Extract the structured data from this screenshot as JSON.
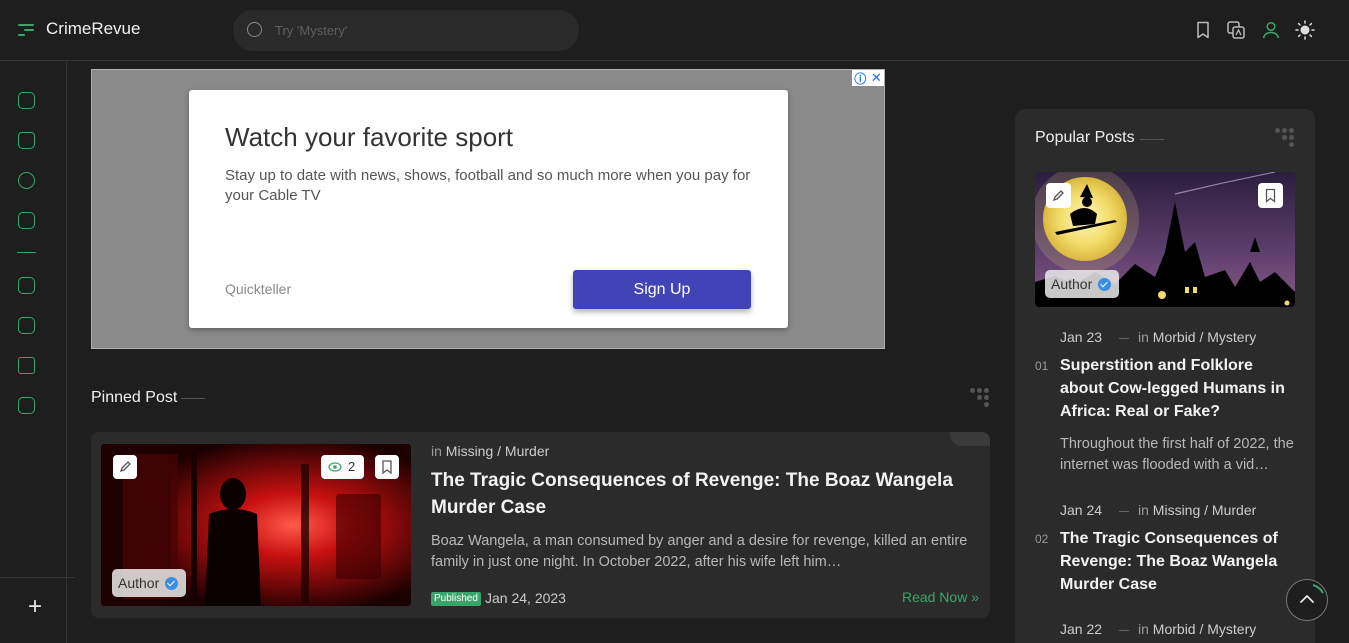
{
  "header": {
    "brand": "CrimeRevue",
    "search_placeholder": "Try 'Mystery'",
    "icons": [
      "bookmark-icon",
      "translate-icon",
      "user-icon",
      "theme-toggle-icon"
    ]
  },
  "sidebar": {
    "items": [
      "dashboard-icon",
      "home-icon",
      "users-icon",
      "mail-icon",
      "page-icon",
      "page-icon",
      "lock-icon",
      "page-icon"
    ]
  },
  "ad": {
    "title": "Watch your favorite sport",
    "text": "Stay up to date with news, shows, football and so much more when you pay for your Cable TV",
    "brand": "Quickteller",
    "cta": "Sign Up"
  },
  "pinned": {
    "section_title": "Pinned Post",
    "views": "2",
    "author": "Author",
    "in_prefix": "in",
    "category": "Missing / Murder",
    "title": "The Tragic Consequences of Revenge: The Boaz Wangela Murder Case",
    "excerpt": "Boaz Wangela, a man consumed by anger and a desire for revenge, killed an entire family in just one night. In October 2022, after his wife left him…",
    "badge": "Published",
    "date": "Jan 24, 2023",
    "read_more": "Read Now »"
  },
  "popular": {
    "section_title": "Popular Posts",
    "author": "Author",
    "items": [
      {
        "num": "01",
        "date": "Jan 23",
        "in_prefix": "in",
        "category": "Morbid / Mystery",
        "title": "Superstition and Folklore about Cow-legged Humans in Africa: Real or Fake?",
        "excerpt": "Throughout the first half of 2022, the internet was flooded with a vid…"
      },
      {
        "num": "02",
        "date": "Jan 24",
        "in_prefix": "in",
        "category": "Missing / Murder",
        "title": "The Tragic Consequences of Revenge: The Boaz Wangela Murder Case"
      },
      {
        "date": "Jan 22",
        "in_prefix": "in",
        "category": "Morbid / Mystery"
      }
    ]
  },
  "colors": {
    "background": "#1e1e1e",
    "card": "#2b2b2b",
    "accent_green": "#3aa56b",
    "ad_button": "#4144b7"
  }
}
